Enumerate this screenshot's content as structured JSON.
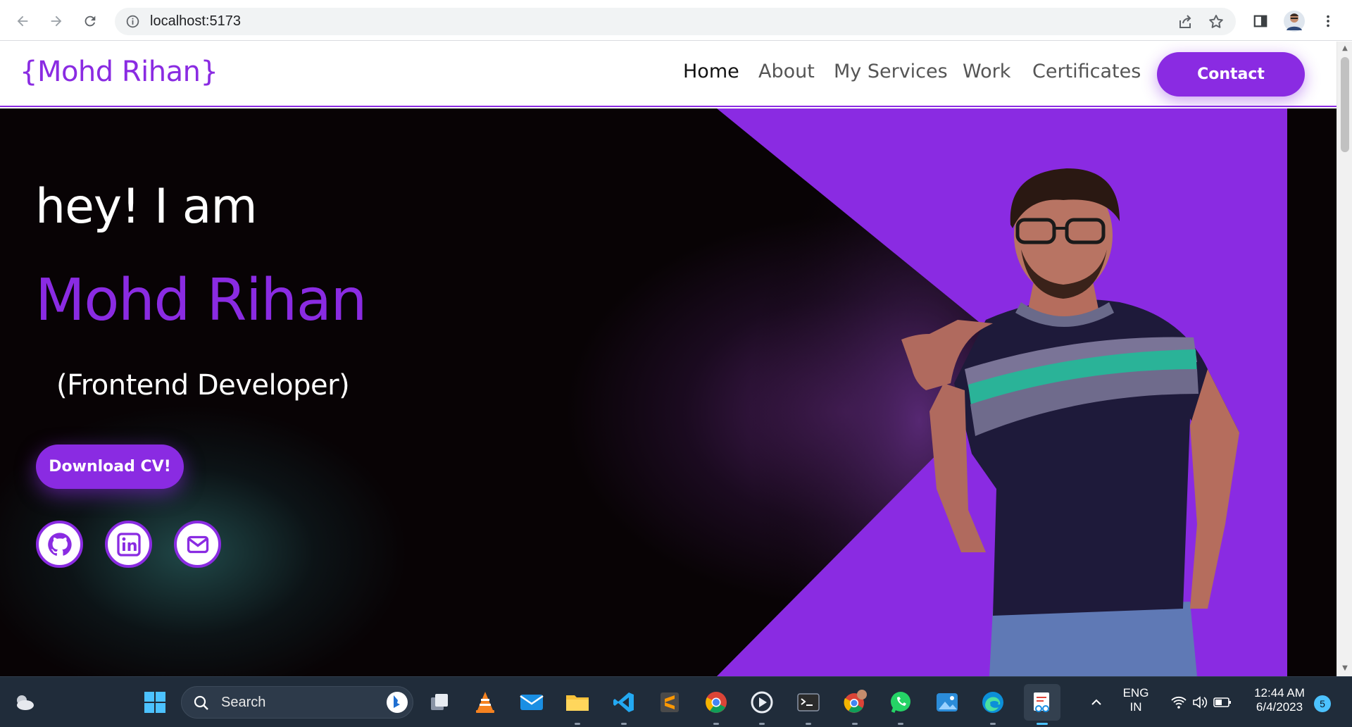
{
  "browser": {
    "url": "localhost:5173"
  },
  "navbar": {
    "logo": "{Mohd Rihan}",
    "links": [
      "Home",
      "About",
      "My Services",
      "Work",
      "Certificates"
    ],
    "active_link": "Home",
    "contact_label": "Contact"
  },
  "hero": {
    "greeting": "hey! I am",
    "name": "Mohd Rihan",
    "role": "(Frontend Developer)",
    "cv_button": "Download CV!",
    "socials": [
      "github-icon",
      "linkedin-icon",
      "mail-icon"
    ]
  },
  "taskbar": {
    "search_label": "Search",
    "language_line1": "ENG",
    "language_line2": "IN",
    "time": "12:44 AM",
    "date": "6/4/2023",
    "notification_count": "5",
    "apps": [
      "task-view-icon",
      "vlc-icon",
      "mail-icon",
      "file-explorer-icon",
      "vscode-icon",
      "sublime-text-icon",
      "chrome-icon",
      "media-player-icon",
      "terminal-icon",
      "chrome-profile-icon",
      "whatsapp-icon",
      "photos-icon",
      "edge-icon",
      "snipping-tool-icon"
    ]
  },
  "colors": {
    "accent": "#8a2be2",
    "hero_bg": "#080305",
    "taskbar_bg": "#202c3a"
  }
}
